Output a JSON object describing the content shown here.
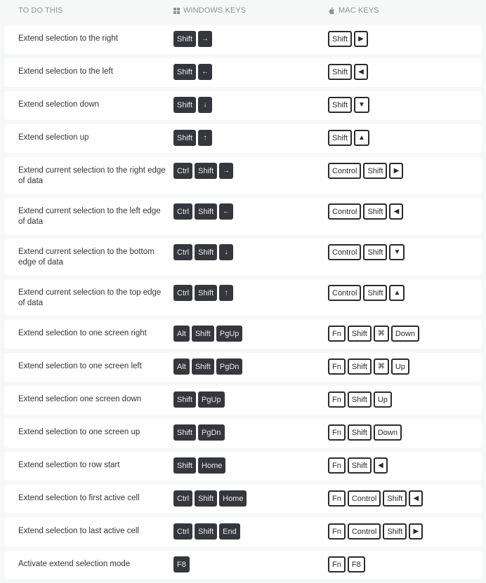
{
  "header": {
    "col_action": "TO DO THIS",
    "col_windows": "WINDOWS KEYS",
    "col_mac": "MAC KEYS",
    "windows_icon": "windows-logo-icon",
    "mac_icon": "apple-logo-icon"
  },
  "colors": {
    "background": "#f6f7f7",
    "row_background": "#ffffff",
    "windows_key_bg": "#35373c",
    "mac_key_border": "#2b2b2b",
    "header_text": "#8d9399"
  },
  "rows": [
    {
      "action": "Extend selection to the right",
      "windows": [
        "Shift",
        "→"
      ],
      "mac": [
        "Shift",
        "▶"
      ]
    },
    {
      "action": "Extend selection to the left",
      "windows": [
        "Shift",
        "←"
      ],
      "mac": [
        "Shift",
        "◀"
      ]
    },
    {
      "action": "Extend selection down",
      "windows": [
        "Shift",
        "↓"
      ],
      "mac": [
        "Shift",
        "▼"
      ]
    },
    {
      "action": "Extend selection up",
      "windows": [
        "Shift",
        "↑"
      ],
      "mac": [
        "Shift",
        "▲"
      ]
    },
    {
      "action": "Extend current selection to the right edge of data",
      "windows": [
        "Ctrl",
        "Shift",
        "→"
      ],
      "mac": [
        "Control",
        "Shift",
        "▶"
      ]
    },
    {
      "action": "Extend current selection to the left edge of data",
      "windows": [
        "Ctrl",
        "Shift",
        "←"
      ],
      "mac": [
        "Control",
        "Shift",
        "◀"
      ]
    },
    {
      "action": "Extend current selection to the bottom edge of data",
      "windows": [
        "Ctrl",
        "Shift",
        "↓"
      ],
      "mac": [
        "Control",
        "Shift",
        "▼"
      ]
    },
    {
      "action": "Extend current selection to the top edge of data",
      "windows": [
        "Ctrl",
        "Shift",
        "↑"
      ],
      "mac": [
        "Control",
        "Shift",
        "▲"
      ]
    },
    {
      "action": "Extend selection to one screen right",
      "windows": [
        "Alt",
        "Shift",
        "PgUp"
      ],
      "mac": [
        "Fn",
        "Shift",
        "⌘",
        "Down"
      ]
    },
    {
      "action": "Extend selection to one screen left",
      "windows": [
        "Alt",
        "Shift",
        "PgDn"
      ],
      "mac": [
        "Fn",
        "Shift",
        "⌘",
        "Up"
      ]
    },
    {
      "action": "Extend selection one screen down",
      "windows": [
        "Shift",
        "PgUp"
      ],
      "mac": [
        "Fn",
        "Shift",
        "Up"
      ]
    },
    {
      "action": "Extend selection to one screen up",
      "windows": [
        "Shift",
        "PgDn"
      ],
      "mac": [
        "Fn",
        "Shift",
        "Down"
      ]
    },
    {
      "action": "Extend selection to row start",
      "windows": [
        "Shift",
        "Home"
      ],
      "mac": [
        "Fn",
        "Shift",
        "◀"
      ]
    },
    {
      "action": "Extend selection to first active cell",
      "windows": [
        "Ctrl",
        "Shift",
        "Home"
      ],
      "mac": [
        "Fn",
        "Control",
        "Shift",
        "◀"
      ]
    },
    {
      "action": "Extend selection to last active cell",
      "windows": [
        "Ctrl",
        "Shift",
        "End"
      ],
      "mac": [
        "Fn",
        "Control",
        "Shift",
        "▶"
      ]
    },
    {
      "action": "Activate extend selection mode",
      "windows": [
        "F8"
      ],
      "mac": [
        "Fn",
        "F8"
      ]
    }
  ]
}
